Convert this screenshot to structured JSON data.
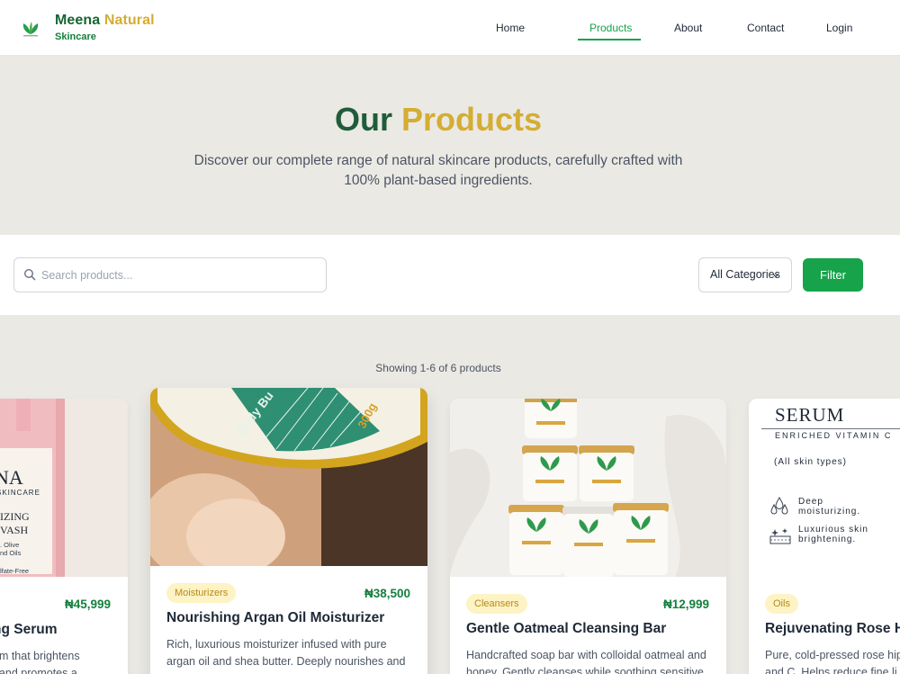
{
  "brand": {
    "name_part1": "Meena",
    "name_part2": "Natural",
    "tagline": "Skincare"
  },
  "nav": {
    "home": "Home",
    "products": "Products",
    "about": "About",
    "contact": "Contact",
    "login": "Login",
    "active": "Products"
  },
  "hero": {
    "title_part1": "Our",
    "title_part2": "Products",
    "subtitle": "Discover our complete range of natural skincare products, carefully crafted with 100% plant-based ingredients."
  },
  "filters": {
    "search_placeholder": "Search products...",
    "category_selected": "All Categories",
    "filter_button": "Filter"
  },
  "results": {
    "count_text": "Showing 1-6 of 6 products"
  },
  "products": [
    {
      "title": "ng Serum",
      "category": "",
      "price": "₦45,999",
      "description": "um that brightens\n, and promotes a",
      "image_text": [
        "NA",
        "SKINCARE",
        "IZING",
        "VASH",
        ". Olive",
        "nd Oils",
        "lfate-Free"
      ]
    },
    {
      "title": "Nourishing Argan Oil Moisturizer",
      "category": "Moisturizers",
      "price": "₦38,500",
      "description": "Rich, luxurious moisturizer infused with pure argan oil and shea butter. Deeply nourishes and",
      "image_text": [
        "Body Bu",
        "300g"
      ]
    },
    {
      "title": "Gentle Oatmeal Cleansing Bar",
      "category": "Cleansers",
      "price": "₦12,999",
      "description": "Handcrafted soap bar with colloidal oatmeal and honey. Gently cleanses while soothing sensitive",
      "image_text": []
    },
    {
      "title": "Rejuvenating Rose H",
      "category": "Oils",
      "price": "",
      "description": "Pure, cold-pressed rose hip\nand C. Helps reduce fine li",
      "image_text": [
        "SERUM",
        "ENRICHED VITAMIN C",
        "(All skin types)",
        "Deep",
        "moisturizing.",
        "Luxurious skin",
        "brightening."
      ]
    }
  ],
  "colors": {
    "primary_green": "#16a34a",
    "brand_green": "#166534",
    "gold": "#d4ad33",
    "hero_bg": "#ebe9e4"
  }
}
